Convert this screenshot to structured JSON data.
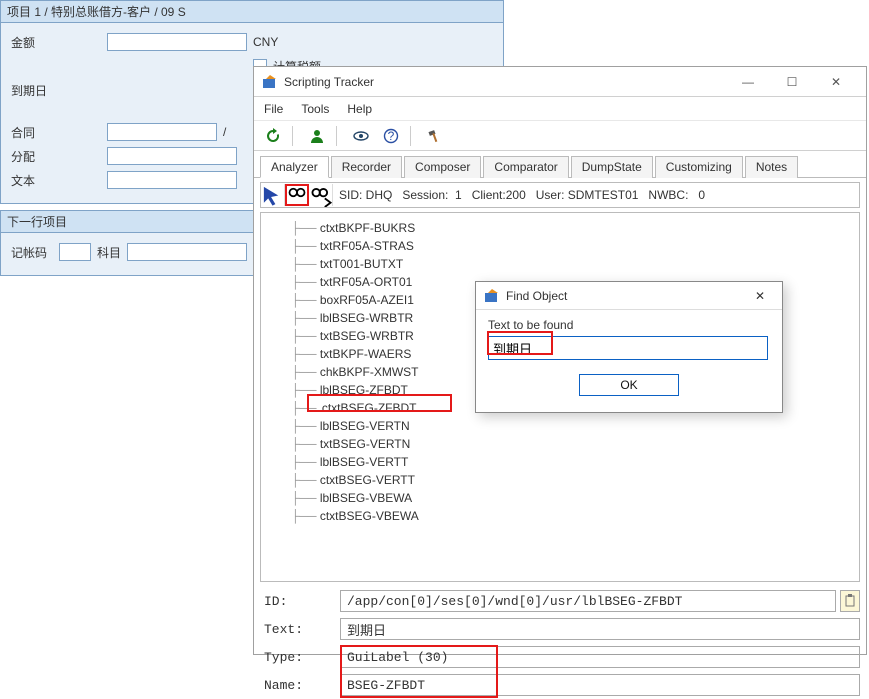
{
  "sap": {
    "panel1_title": "项目 1 / 特别总账借方-客户 / 09 S",
    "amount_label": "金额",
    "amount_value": "",
    "currency": "CNY",
    "calc_tax": "计算税额",
    "due_label": "到期日",
    "due_value": "",
    "due_checked": "✓",
    "contract_label": "合同",
    "contract_value": "",
    "slash": "/",
    "alloc_label": "分配",
    "alloc_value": "",
    "text_label": "文本",
    "text_value": "",
    "panel2_title": "下一行项目",
    "postkey_label": "记帐码",
    "postkey_value": "",
    "account_label": "科目",
    "account_value": ""
  },
  "tracker": {
    "title": "Scripting Tracker",
    "menu": {
      "file": "File",
      "tools": "Tools",
      "help": "Help"
    },
    "tabs": [
      "Analyzer",
      "Recorder",
      "Composer",
      "Comparator",
      "DumpState",
      "Customizing",
      "Notes"
    ],
    "statusbar": "SID: DHQ   Session:  1   Client:200   User: SDMTEST01   NWBC:   0",
    "tree": [
      "ctxtBKPF-BUKRS",
      "txtRF05A-STRAS",
      "txtT001-BUTXT",
      "txtRF05A-ORT01",
      "boxRF05A-AZEI1",
      "lblBSEG-WRBTR",
      "txtBSEG-WRBTR",
      "txtBKPF-WAERS",
      "chkBKPF-XMWST",
      "lblBSEG-ZFBDT",
      "ctxtBSEG-ZFBDT",
      "lblBSEG-VERTN",
      "txtBSEG-VERTN",
      "lblBSEG-VERTT",
      "ctxtBSEG-VERTT",
      "lblBSEG-VBEWA",
      "ctxtBSEG-VBEWA"
    ],
    "props": {
      "id_label": "ID:",
      "id": "/app/con[0]/ses[0]/wnd[0]/usr/lblBSEG-ZFBDT",
      "text_label": "Text:",
      "text": "到期日",
      "type_label": "Type:",
      "type": "GuiLabel (30)",
      "name_label": "Name:",
      "name": "BSEG-ZFBDT"
    }
  },
  "dialog": {
    "title": "Find Object",
    "label": "Text to be found",
    "value": "到期日",
    "ok": "OK"
  },
  "sysbtns": {
    "min": "—",
    "max": "☐",
    "close": "✕"
  }
}
